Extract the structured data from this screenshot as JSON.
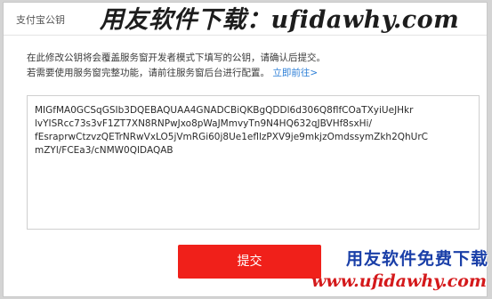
{
  "window": {
    "title": "支付宝公钥"
  },
  "watermark": {
    "top_text": "用友软件下载：ufidawhy.com"
  },
  "description": {
    "line1": "在此修改公钥将会覆盖服务窗开发者模式下填写的公钥，请确认后提交。",
    "line2_prefix": "若需要使用服务窗完整功能，请前往服务窗后台进行配置。",
    "line2_link": "立即前往>"
  },
  "public_key": {
    "lines": [
      "MIGfMA0GCSqGSIb3DQEBAQUAA4GNADCBiQKBgQDDl6d306Q8flfCOaTXyiUeJHkr",
      "lvYISRcc73s3vF1ZT7XN8RNPwJxo8pWaJMmvyTn9N4HQ632qJBVHf8sxHi/",
      "fEsraprwCtzvzQETrNRwVxLO5jVmRGi60j8Ue1efllzPXV9je9mkjzOmdssymZkh2QhUrC",
      "mZYl/FCEa3/cNMW0QIDAQAB"
    ]
  },
  "buttons": {
    "submit_label": "提交"
  },
  "logo": {
    "cn_text": "用友软件免费下载",
    "url_text": "www.ufidawhy.com"
  },
  "colors": {
    "submit_bg": "#f0201a",
    "link": "#2d7fd7",
    "logo_blue": "#1a3fa8",
    "logo_red": "#d4191b"
  }
}
